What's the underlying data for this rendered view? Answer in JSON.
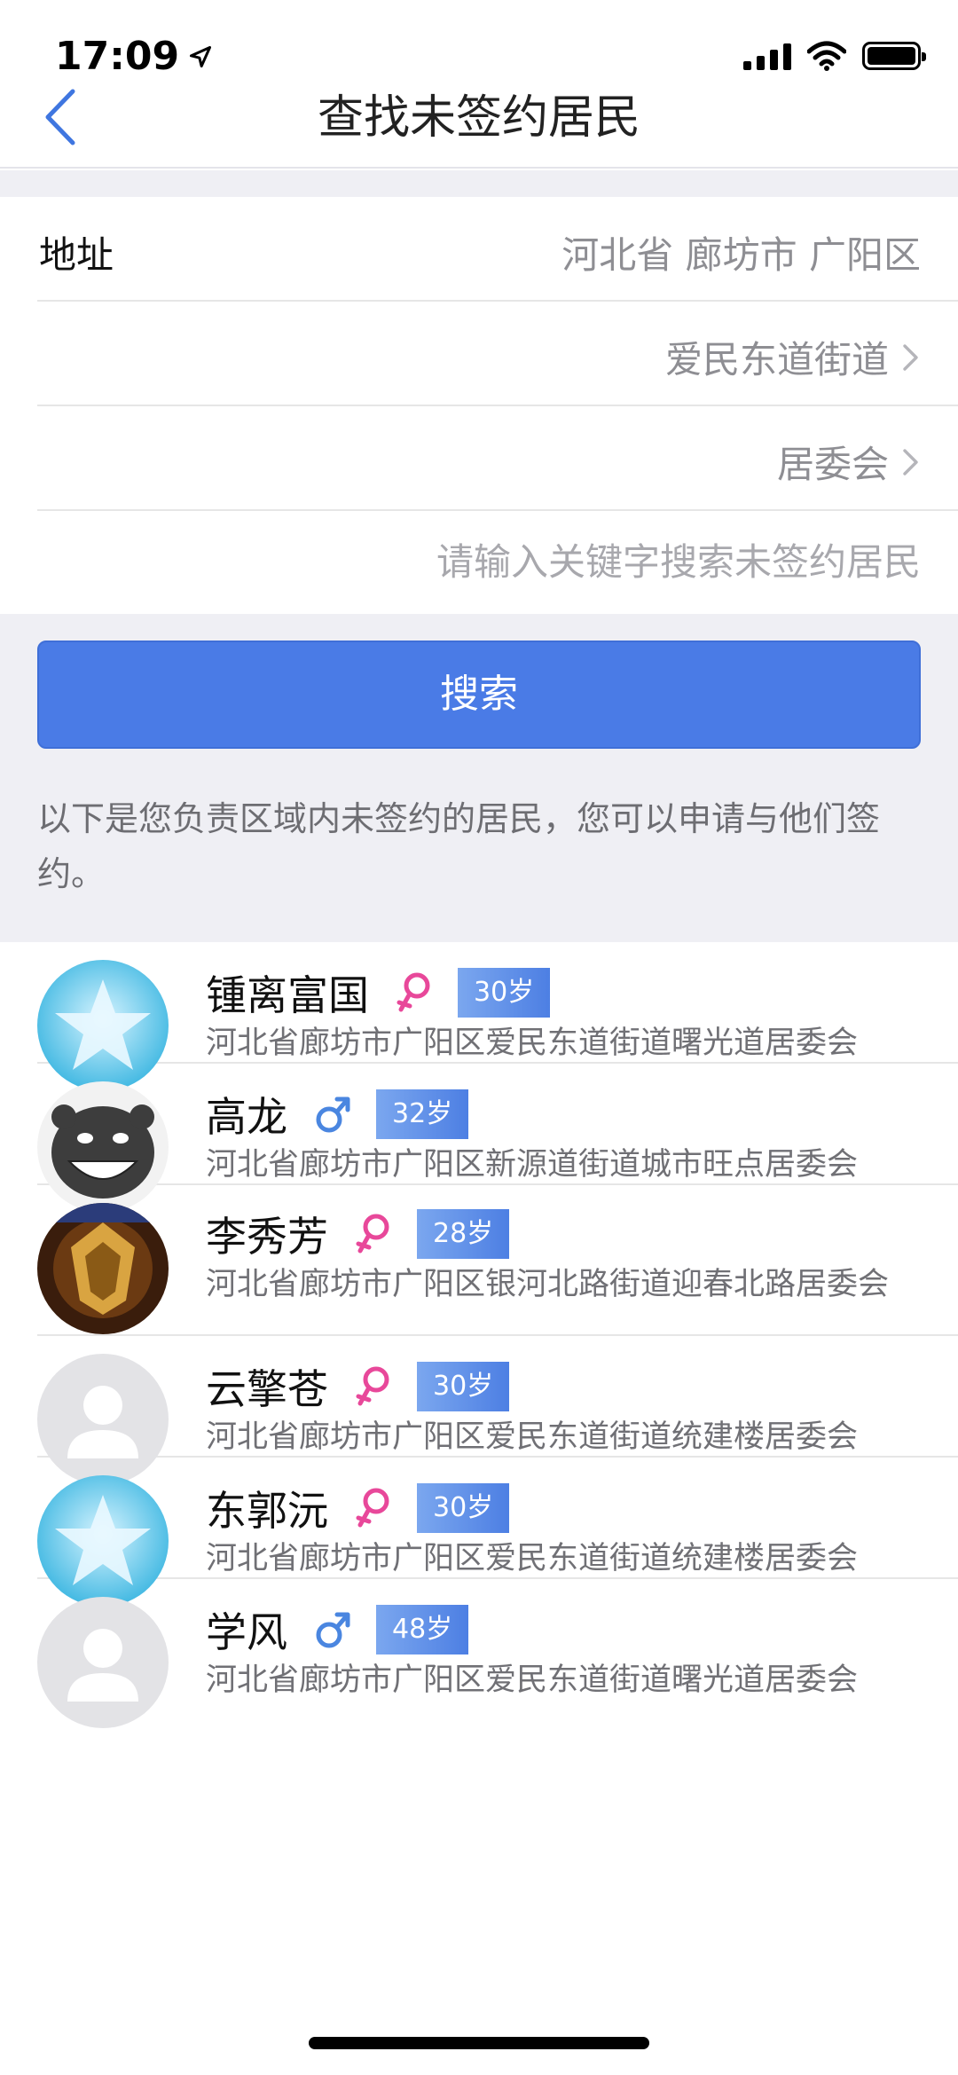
{
  "status_bar": {
    "time": "17:09"
  },
  "nav": {
    "title": "查找未签约居民"
  },
  "form": {
    "address_label": "地址",
    "region": "河北省 廊坊市 广阳区",
    "street": "爱民东道街道",
    "committee": "居委会",
    "keyword_placeholder": "请输入关键字搜索未签约居民"
  },
  "search_button": "搜索",
  "notice": "以下是您负责区域内未签约的居民，您可以申请与他们签约。",
  "residents": [
    {
      "name": "锺离富国",
      "gender": "female",
      "age": "30岁",
      "address": "河北省廊坊市广阳区爱民东道街道曙光道居委会",
      "avatar": "star-avatar"
    },
    {
      "name": "高龙",
      "gender": "male",
      "age": "32岁",
      "address": "河北省廊坊市广阳区新源道街道城市旺点居委会",
      "avatar": "cartoon-avatar"
    },
    {
      "name": "李秀芳",
      "gender": "female",
      "age": "28岁",
      "address": "河北省廊坊市广阳区银河北路街道迎春北路居委会",
      "avatar": "game-badge-avatar"
    },
    {
      "name": "云擎苍",
      "gender": "female",
      "age": "30岁",
      "address": "河北省廊坊市广阳区爱民东道街道统建楼居委会",
      "avatar": "default-avatar"
    },
    {
      "name": "东郭沅",
      "gender": "female",
      "age": "30岁",
      "address": "河北省廊坊市广阳区爱民东道街道统建楼居委会",
      "avatar": "star-avatar"
    },
    {
      "name": "学风",
      "gender": "male",
      "age": "48岁",
      "address": "河北省廊坊市广阳区爱民东道街道曙光道居委会",
      "avatar": "default-avatar"
    }
  ],
  "colors": {
    "accent": "#4a7be6",
    "female": "#e8489a",
    "male": "#4a86e0",
    "background_grey": "#efeff4"
  }
}
